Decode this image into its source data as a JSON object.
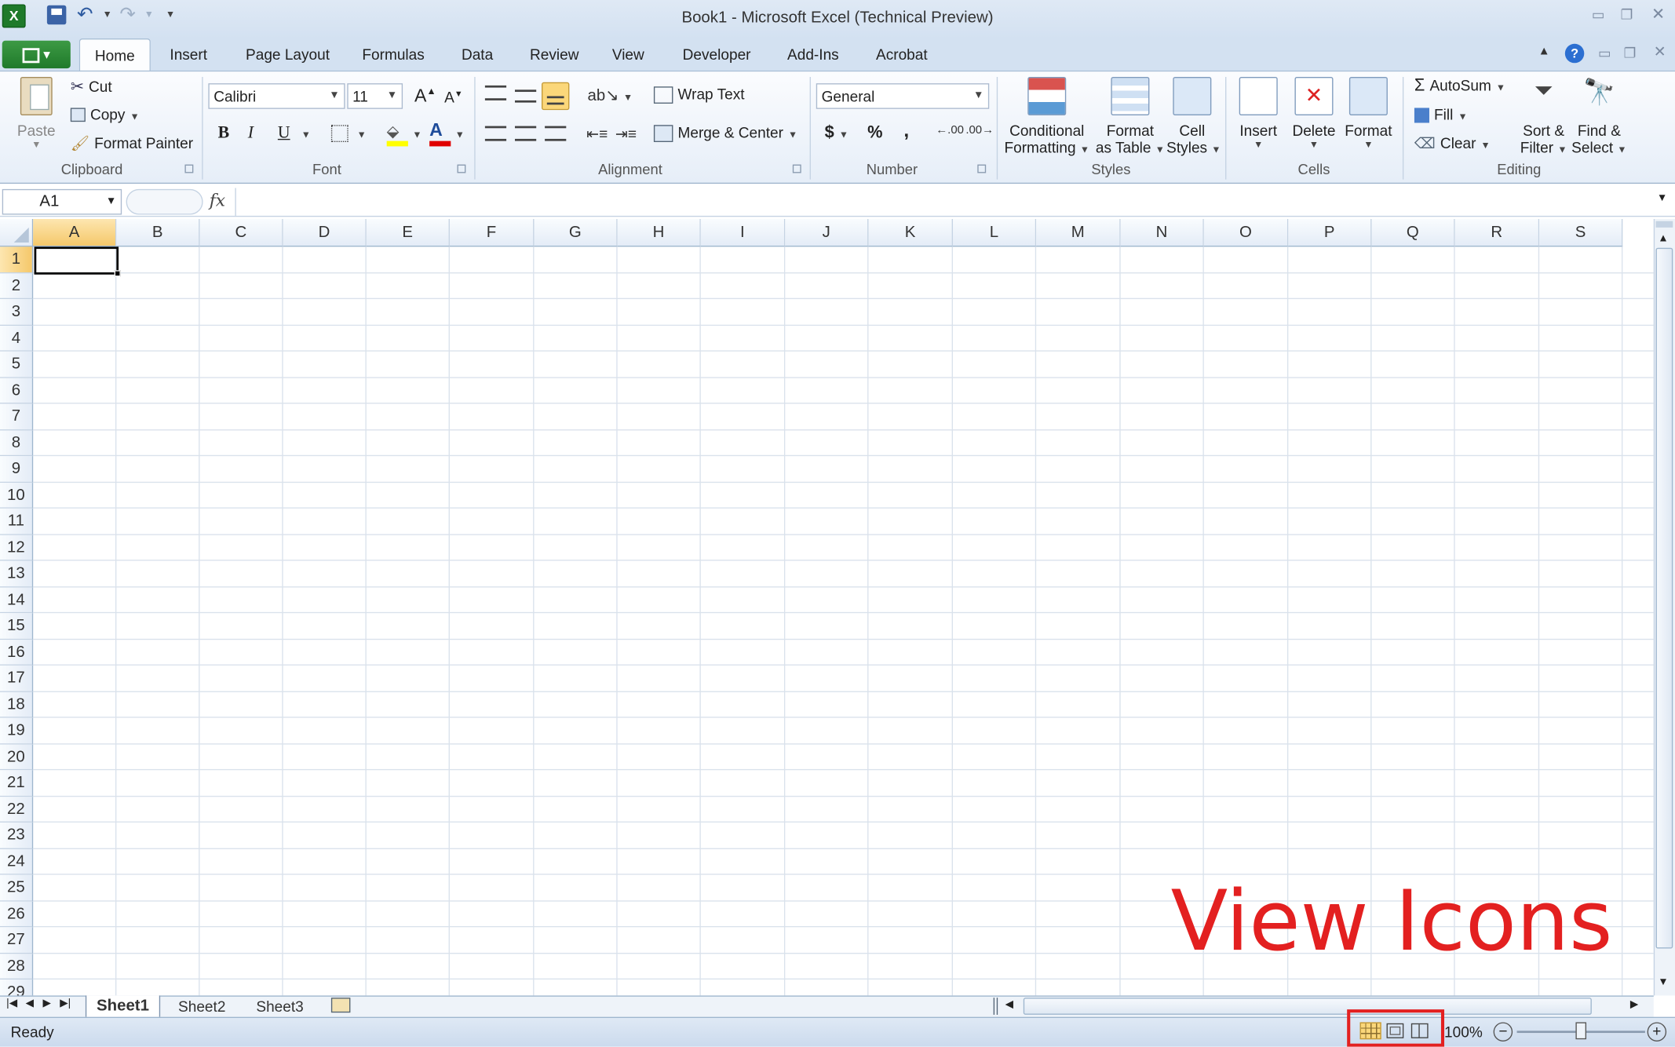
{
  "window": {
    "title": "Book1  -  Microsoft Excel (Technical Preview)"
  },
  "tabs": [
    "Home",
    "Insert",
    "Page Layout",
    "Formulas",
    "Data",
    "Review",
    "View",
    "Developer",
    "Add-Ins",
    "Acrobat"
  ],
  "clipboard": {
    "paste": "Paste",
    "cut": "Cut",
    "copy": "Copy",
    "format_painter": "Format Painter",
    "group": "Clipboard"
  },
  "font": {
    "name": "Calibri",
    "size": "11",
    "bold": "B",
    "italic": "I",
    "underline": "U",
    "group": "Font",
    "grow": "A",
    "shrink": "A"
  },
  "alignment": {
    "wrap": "Wrap Text",
    "merge": "Merge & Center",
    "group": "Alignment"
  },
  "number": {
    "format": "General",
    "currency": "$",
    "percent": "%",
    "comma": ",",
    "inc_decimal": ".00",
    "dec_decimal": ".00",
    "group": "Number"
  },
  "styles": {
    "conditional_1": "Conditional",
    "conditional_2": "Formatting",
    "table_1": "Format",
    "table_2": "as Table",
    "cell_1": "Cell",
    "cell_2": "Styles",
    "group": "Styles"
  },
  "cells": {
    "insert": "Insert",
    "delete": "Delete",
    "format": "Format",
    "group": "Cells"
  },
  "editing": {
    "autosum": "AutoSum",
    "fill": "Fill",
    "clear": "Clear",
    "sort_1": "Sort &",
    "sort_2": "Filter",
    "find_1": "Find &",
    "find_2": "Select",
    "group": "Editing"
  },
  "formula_bar": {
    "name_box": "A1",
    "fx": "fx",
    "formula": ""
  },
  "columns": [
    "A",
    "B",
    "C",
    "D",
    "E",
    "F",
    "G",
    "H",
    "I",
    "J",
    "K",
    "L",
    "M",
    "N",
    "O",
    "P",
    "Q",
    "R",
    "S"
  ],
  "rows": [
    "1",
    "2",
    "3",
    "4",
    "5",
    "6",
    "7",
    "8",
    "9",
    "10",
    "11",
    "12",
    "13",
    "14",
    "15",
    "16",
    "17",
    "18",
    "19",
    "20",
    "21",
    "22",
    "23",
    "24",
    "25",
    "26",
    "27",
    "28",
    "29"
  ],
  "sheets": [
    "Sheet1",
    "Sheet2",
    "Sheet3"
  ],
  "status": {
    "ready": "Ready",
    "zoom": "100%"
  },
  "annotation": "View Icons",
  "colors": {
    "annotation": "#e32020",
    "selected_header": "#f5c86a",
    "file_tab": "#1f7a2a"
  }
}
